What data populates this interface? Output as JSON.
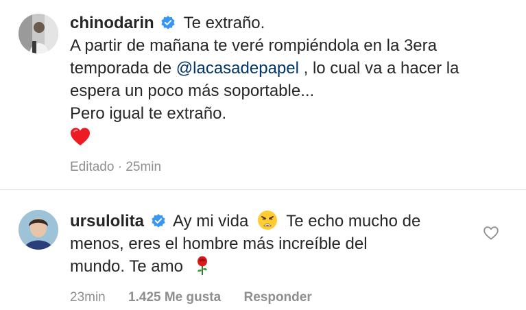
{
  "post": {
    "username": "chinodarin",
    "caption_first": "Te extraño.",
    "lines": [
      "A partir de mañana te veré rompiéndola en la 3era",
      "temporada de ",
      ", lo cual va a hacer la",
      "espera un poco más soportable...",
      "Pero igual te extraño."
    ],
    "mention": "@lacasadepapel",
    "edited_label": "Editado",
    "separator": "·",
    "time": "25min"
  },
  "reply": {
    "username": "ursulolita",
    "text_first": "Ay mi vida",
    "text_after_emoji": "Te echo mucho de",
    "line2": "menos, eres el hombre más increíble del",
    "line3": "mundo. Te amo",
    "time": "23min",
    "likes": "1.425 Me gusta",
    "reply_label": "Responder"
  },
  "icons": {
    "verified": "verified-badge-icon",
    "heart_emoji": "red-heart-emoji",
    "weary_emoji": "weary-face-emoji",
    "rose_emoji": "rose-emoji",
    "like": "heart-outline-icon"
  },
  "colors": {
    "verified": "#3897f0",
    "mention": "#003569",
    "meta": "#8e8e8e",
    "heart": "#ed4956"
  }
}
